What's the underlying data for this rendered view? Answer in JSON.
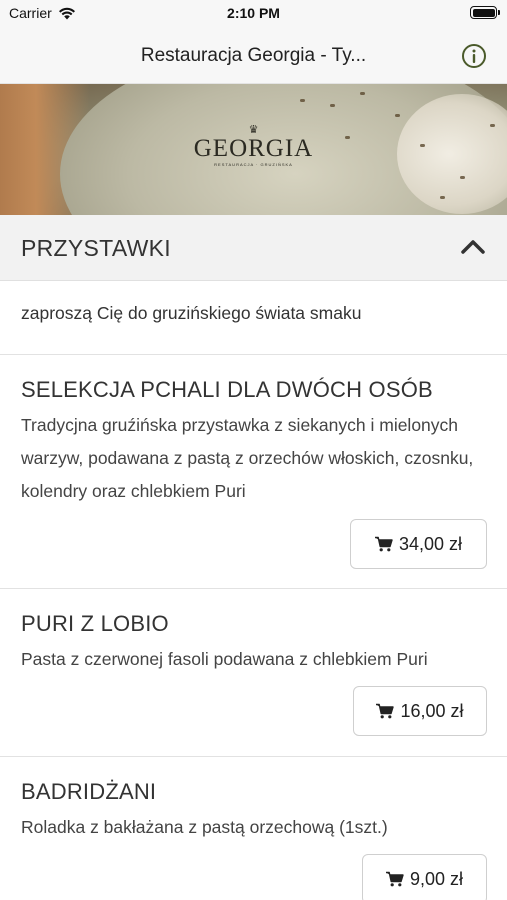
{
  "status_bar": {
    "carrier": "Carrier",
    "time": "2:10 PM"
  },
  "nav": {
    "title": "Restauracja Georgia - Ty..."
  },
  "banner": {
    "logo_name": "GEORGIA",
    "logo_sub": "RESTAURACJA · GRUZIŃSKA"
  },
  "section": {
    "title": "PRZYSTAWKI",
    "description": "zaproszą Cię do gruzińskiego świata smaku"
  },
  "items": [
    {
      "name": "SELEKCJA PCHALI DLA DWÓCH OSÓB",
      "description": "Tradycjna gruźińska przystawka z siekanych i mielonych warzyw, podawana z pastą z orzechów włoskich, czosnku, kolendry oraz chlebkiem Puri",
      "price": "34,00 zł"
    },
    {
      "name": "PURI Z LOBIO",
      "description": "Pasta z czerwonej fasoli podawana z chlebkiem Puri",
      "price": "16,00 zł"
    },
    {
      "name": "BADRIDŻANI",
      "description": "Roladka z bakłażana z pastą orzechową (1szt.)",
      "price": "9,00 zł"
    }
  ],
  "icons": {
    "info": "info-circle-icon",
    "chevron": "chevron-up-icon",
    "cart": "cart-icon",
    "wifi": "wifi-icon",
    "battery": "battery-icon"
  },
  "colors": {
    "accent": "#4a5a2a",
    "header_bg": "#f7f7f7",
    "section_bg": "#f2f2f2"
  }
}
